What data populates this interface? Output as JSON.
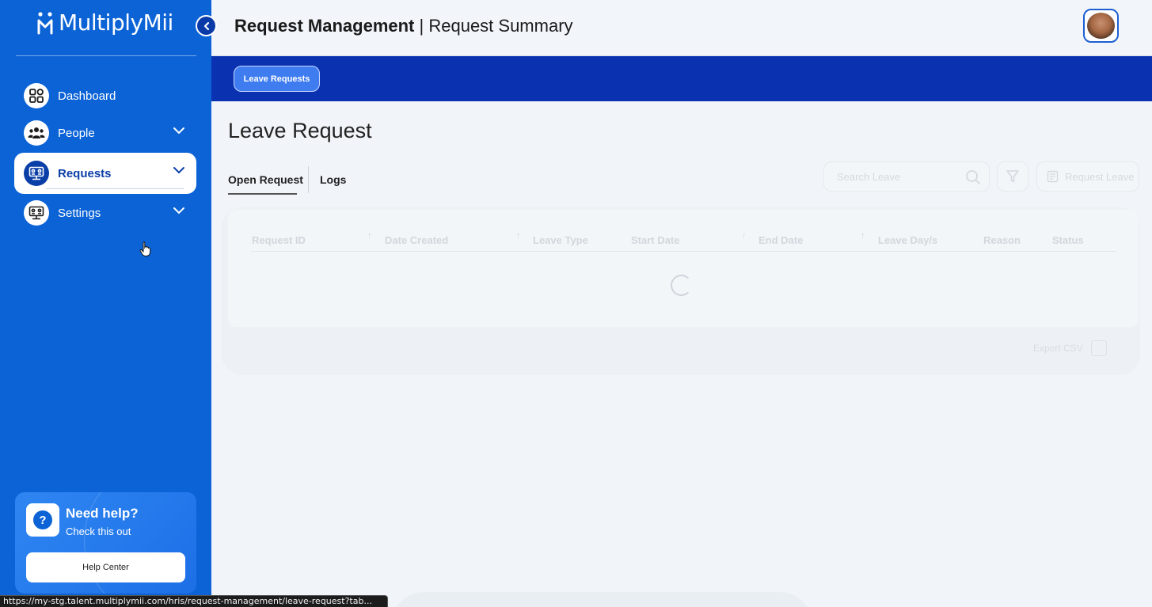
{
  "app": {
    "name": "MultiplyMii"
  },
  "sidebar": {
    "items": [
      {
        "label": "Dashboard",
        "icon": "dashboard-grid-icon"
      },
      {
        "label": "People",
        "icon": "people-group-icon"
      },
      {
        "label": "Requests",
        "icon": "requests-board-icon"
      },
      {
        "label": "Settings",
        "icon": "settings-board-icon"
      }
    ],
    "active": "Requests",
    "help": {
      "title": "Need help?",
      "subtitle": "Check this out",
      "button_label": "Help Center"
    }
  },
  "header": {
    "title_bold": "Request Management",
    "title_sep": " | ",
    "title_rest": "Request Summary"
  },
  "band": {
    "tab_label": "Leave Requests"
  },
  "main": {
    "title": "Leave Request",
    "tabs": [
      {
        "label": "Open Request"
      },
      {
        "label": "Logs"
      }
    ],
    "active_tab": "Open Request",
    "search": {
      "placeholder": "Search Leave"
    },
    "request_button": "Request Leave",
    "table": {
      "columns": [
        "Request ID",
        "Date Created",
        "Leave Type",
        "Start Date",
        "End Date",
        "Leave Day/s",
        "Reason",
        "Status"
      ]
    },
    "export_label": "Export CSV"
  },
  "statusbar": {
    "url": "https://my-stg.talent.multiplymii.com/hris/request-management/leave-request?tab..."
  },
  "colors": {
    "sidebar": "#0b63d6",
    "band": "#0a31b0",
    "active_tab_pill": "#3f7cf0"
  }
}
